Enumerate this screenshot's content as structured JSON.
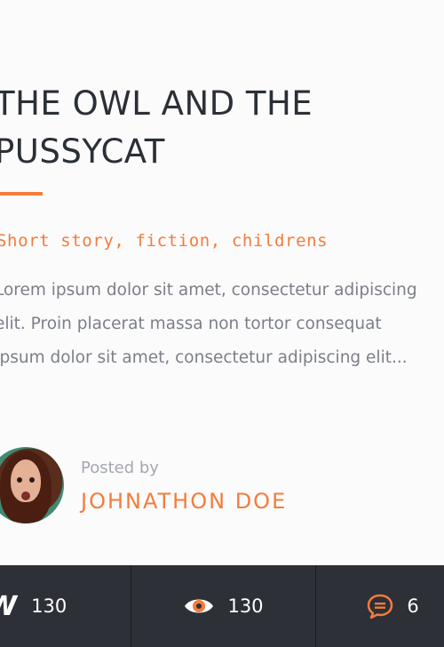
{
  "article": {
    "title": "THE OWL AND THE\nPUSSYCAT",
    "tags": "Short story, fiction, childrens",
    "excerpt": "Lorem ipsum dolor sit amet, consectetur adipiscing elit. Proin placerat massa non tortor consequat Ipsum dolor sit amet, consectetur adipiscing elit..."
  },
  "author": {
    "posted_label": "Posted by",
    "name": "JOHNATHON DOE"
  },
  "stats": {
    "likes_icon": "w-logo-icon",
    "likes_glyph": "W",
    "likes": "130",
    "views_icon": "eye-icon",
    "views": "130",
    "comments_icon": "comment-icon",
    "comments": "6"
  },
  "colors": {
    "accent": "#f47c3c",
    "title": "#2b2f36",
    "body_text": "#7b7f86",
    "footer_bg": "#2d3037"
  }
}
